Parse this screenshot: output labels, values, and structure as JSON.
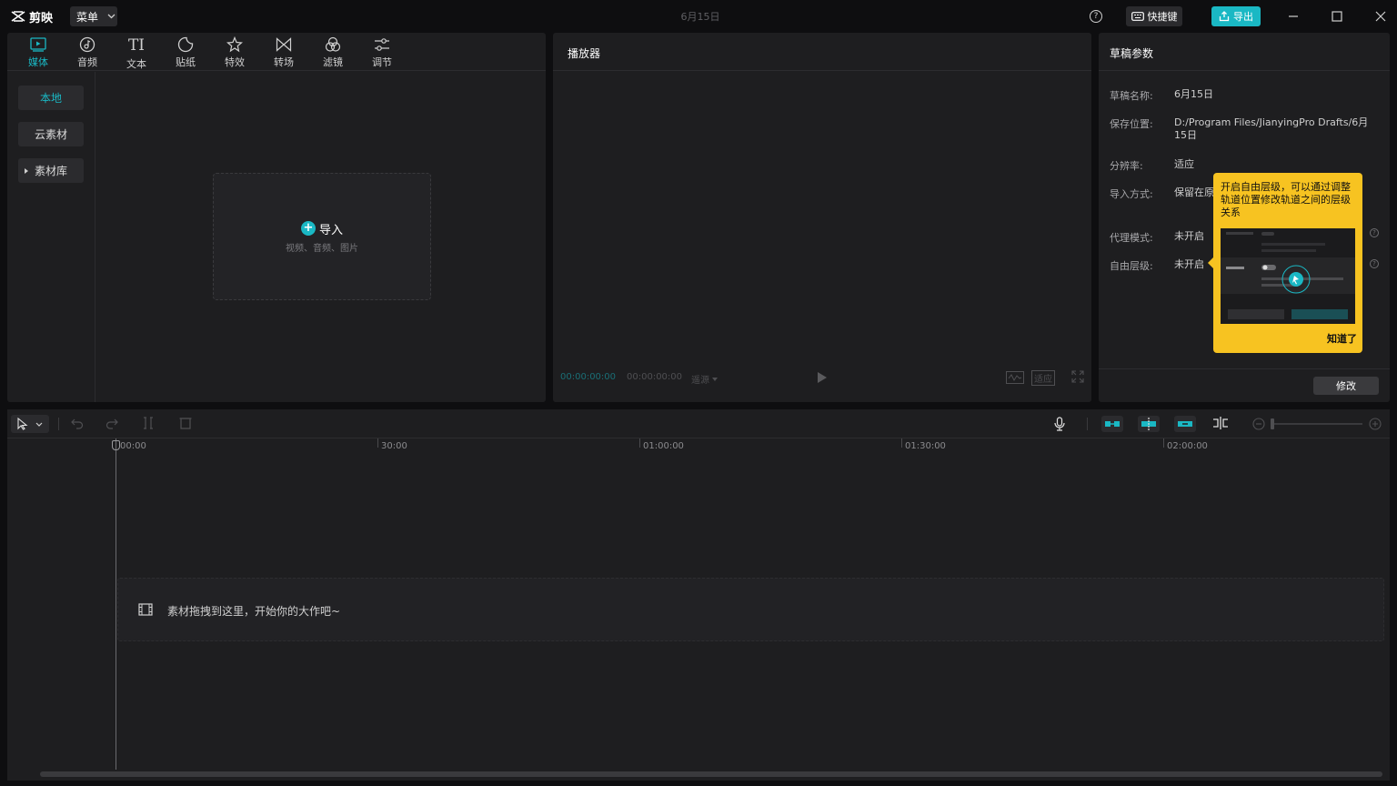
{
  "app": {
    "logo_text": "剪映",
    "menu_label": "菜单",
    "window_title": "6月15日",
    "shortcut_label": "快捷键",
    "export_label": "导出"
  },
  "media": {
    "tabs": [
      {
        "label": "媒体",
        "icon": "media-icon",
        "active": true
      },
      {
        "label": "音频",
        "icon": "audio-icon"
      },
      {
        "label": "文本",
        "icon": "text-icon"
      },
      {
        "label": "贴纸",
        "icon": "sticker-icon"
      },
      {
        "label": "特效",
        "icon": "effect-icon"
      },
      {
        "label": "转场",
        "icon": "transition-icon"
      },
      {
        "label": "滤镜",
        "icon": "filter-icon"
      },
      {
        "label": "调节",
        "icon": "adjust-icon"
      }
    ],
    "side": [
      "本地",
      "云素材",
      "素材库"
    ],
    "import_label": "导入",
    "import_hint": "视频、音频、图片"
  },
  "player": {
    "title": "播放器",
    "current_time": "00:00:00:00",
    "total_time": "00:00:00:00",
    "quality_label": "遥源",
    "ratio_label": "适应"
  },
  "draft": {
    "title": "草稿参数",
    "rows": [
      {
        "label": "草稿名称:",
        "value": "6月15日"
      },
      {
        "label": "保存位置:",
        "value": "D:/Program Files/JianyingPro Drafts/6月15日"
      },
      {
        "label": "分辨率:",
        "value": "适应"
      },
      {
        "label": "导入方式:",
        "value": "保留在原"
      },
      {
        "label": "代理模式:",
        "value": "未开启"
      },
      {
        "label": "自由层级:",
        "value": "未开启"
      }
    ],
    "modify_label": "修改"
  },
  "tooltip": {
    "text": "开启自由层级，可以通过调整轨道位置修改轨道之间的层级关系",
    "ok_label": "知道了"
  },
  "timeline": {
    "ticks": [
      "00:00",
      "30:00",
      "01:00:00",
      "01:30:00",
      "02:00:00"
    ],
    "drop_text": "素材拖拽到这里，开始你的大作吧~"
  },
  "colors": {
    "accent": "#1ab8c4",
    "tooltip": "#f7c321",
    "panel": "#1e1e20",
    "background": "#0e0e10"
  }
}
